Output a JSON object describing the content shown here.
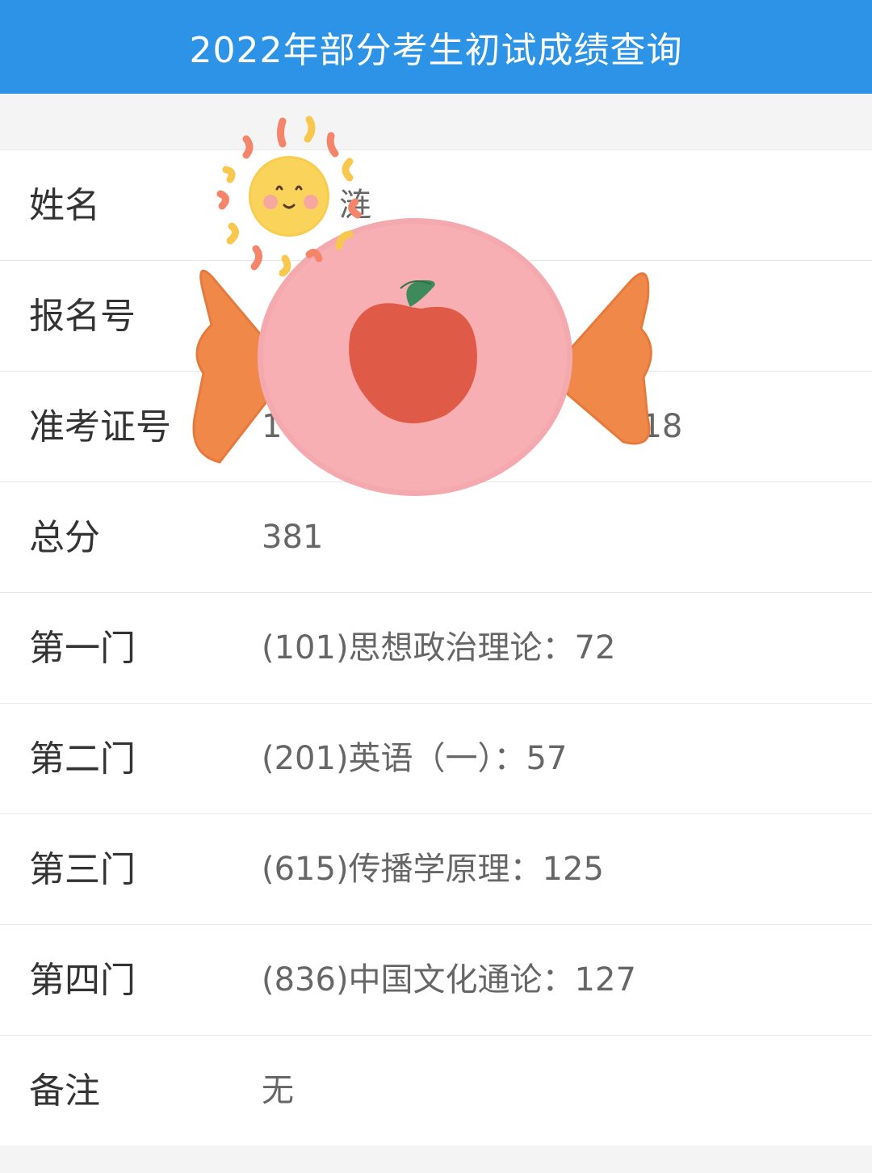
{
  "header": {
    "title": "2022年部分考生初试成绩查询"
  },
  "rows": [
    {
      "label": "姓名",
      "value": "涟"
    },
    {
      "label": "报名号",
      "value": ""
    },
    {
      "label": "准考证号",
      "value": "1                                   18"
    },
    {
      "label": "总分",
      "value": "381"
    },
    {
      "label": "第一门",
      "value": "(101)思想政治理论：72"
    },
    {
      "label": "第二门",
      "value": "(201)英语（一）：57"
    },
    {
      "label": "第三门",
      "value": "(615)传播学原理：125"
    },
    {
      "label": "第四门",
      "value": "(836)中国文化通论：127"
    },
    {
      "label": "备注",
      "value": "无"
    }
  ],
  "colors": {
    "header_bg": "#2d93e6",
    "label_text": "#333333",
    "value_text": "#666666"
  },
  "icons": [
    "sun-sticker-icon",
    "candy-apple-sticker-icon"
  ]
}
